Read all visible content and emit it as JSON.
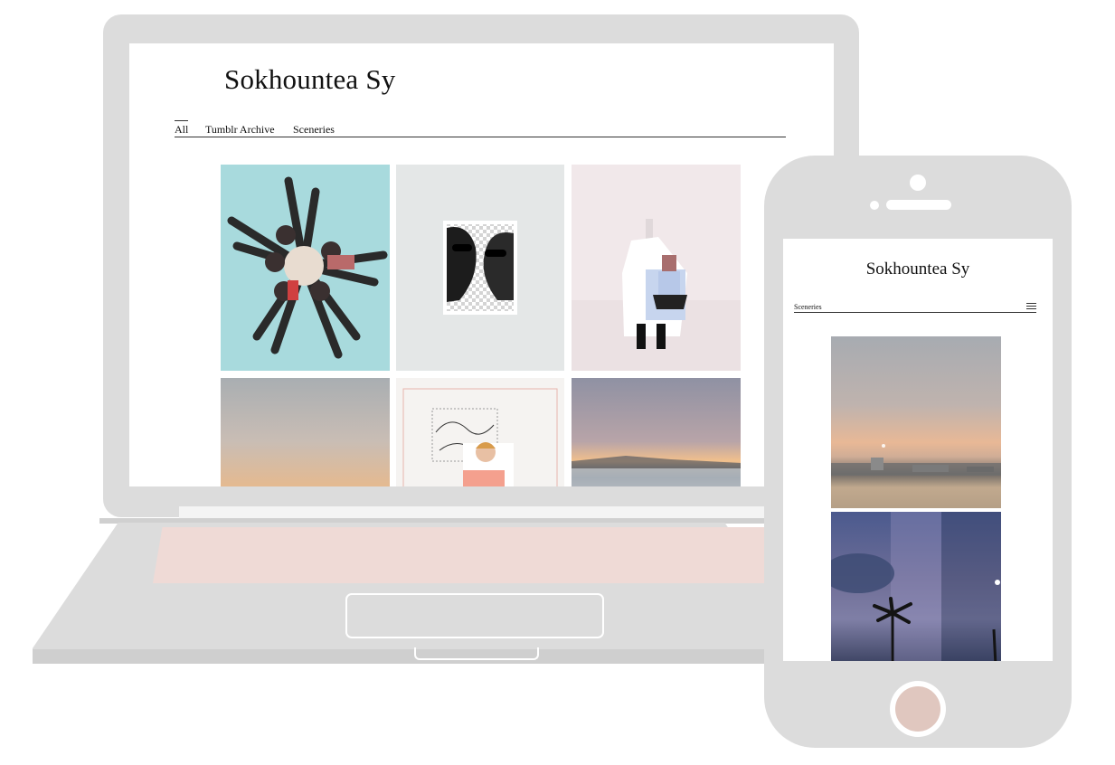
{
  "desktop": {
    "site_title": "Sokhountea Sy",
    "nav": [
      "All",
      "Tumblr Archive",
      "Sceneries"
    ],
    "active_nav": "All"
  },
  "mobile": {
    "site_title": "Sokhountea Sy",
    "nav_label": "Sceneries",
    "menu_icon": "hamburger-menu-icon"
  },
  "colors": {
    "device_gray": "#dcdcdc",
    "keyboard_pink": "#efdad6",
    "home_button": "#e0c7bf"
  }
}
